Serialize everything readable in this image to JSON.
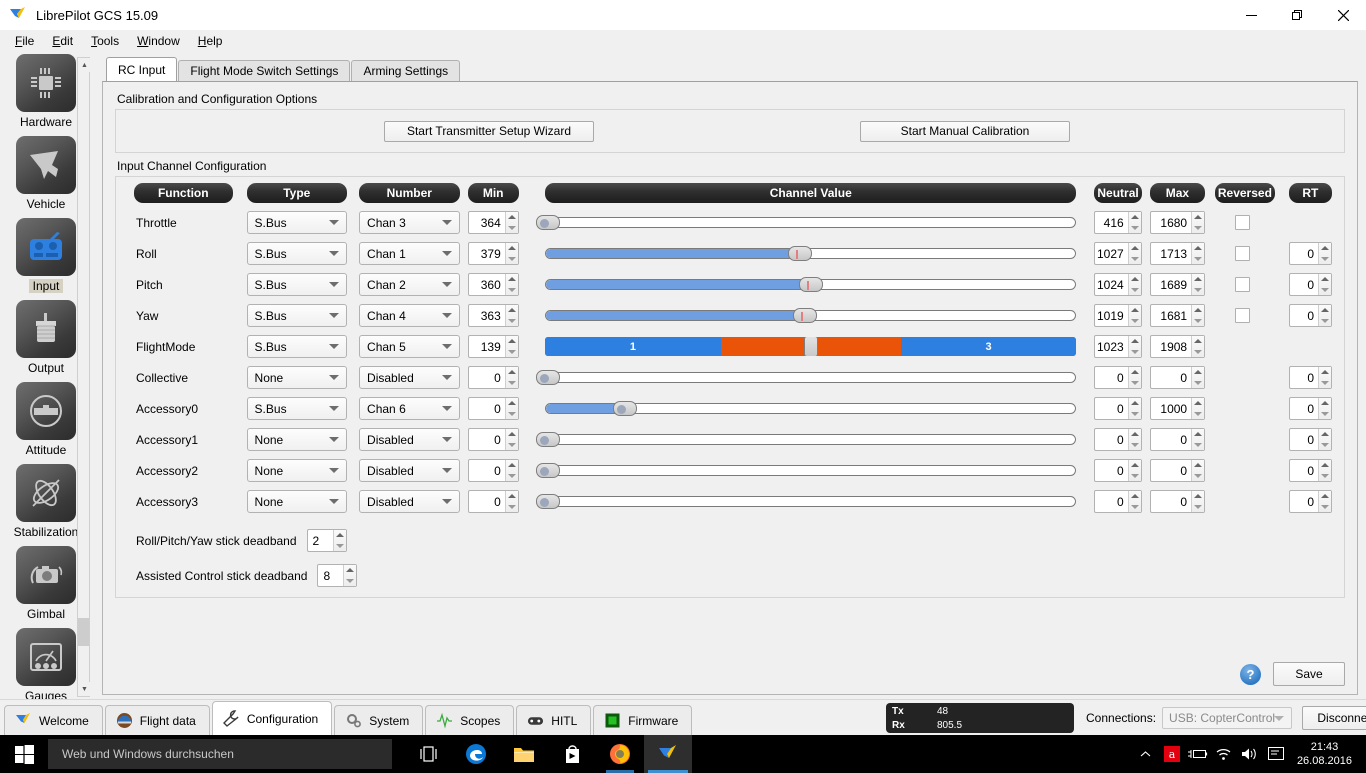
{
  "window": {
    "title": "LibrePilot GCS 15.09",
    "app_icon": "librepilot-logo-icon",
    "minimize": "–",
    "maximize": "❐",
    "close": "✕"
  },
  "menubar": [
    {
      "label": "File",
      "mnemonic": "F"
    },
    {
      "label": "Edit",
      "mnemonic": "E"
    },
    {
      "label": "Tools",
      "mnemonic": "T"
    },
    {
      "label": "Window",
      "mnemonic": "W"
    },
    {
      "label": "Help",
      "mnemonic": "H"
    }
  ],
  "sidebar": {
    "items": [
      {
        "label": "Hardware",
        "icon": "chip-icon",
        "selected": false
      },
      {
        "label": "Vehicle",
        "icon": "airplane-icon",
        "selected": false
      },
      {
        "label": "Input",
        "icon": "rc-transmitter-icon",
        "selected": true
      },
      {
        "label": "Output",
        "icon": "motor-icon",
        "selected": false
      },
      {
        "label": "Attitude",
        "icon": "spirit-level-icon",
        "selected": false
      },
      {
        "label": "Stabilization",
        "icon": "gyro-icon",
        "selected": false
      },
      {
        "label": "Gimbal",
        "icon": "camera-icon",
        "selected": false
      },
      {
        "label": "Gauges",
        "icon": "gauge-icon",
        "selected": false
      }
    ]
  },
  "tabs": [
    {
      "label": "RC Input",
      "active": true
    },
    {
      "label": "Flight Mode Switch Settings",
      "active": false
    },
    {
      "label": "Arming Settings",
      "active": false
    }
  ],
  "calibration": {
    "group_label": "Calibration and Configuration Options",
    "wizard_button": "Start Transmitter Setup Wizard",
    "manual_button": "Start Manual Calibration"
  },
  "input_config": {
    "group_label": "Input Channel Configuration",
    "headers": [
      "Function",
      "Type",
      "Number",
      "Min",
      "Channel Value",
      "Neutral",
      "Max",
      "Reversed",
      "RT"
    ],
    "rows": [
      {
        "function": "Throttle",
        "type": "S.Bus",
        "number": "Chan 3",
        "min": "364",
        "neutral": "416",
        "max": "1680",
        "reversed": false,
        "rt": "",
        "has_rt": false,
        "slider": {
          "style": "plain",
          "fill_pct": 0,
          "handle_pct": 0.5,
          "dot": true
        }
      },
      {
        "function": "Roll",
        "type": "S.Bus",
        "number": "Chan 1",
        "min": "379",
        "neutral": "1027",
        "max": "1713",
        "reversed": false,
        "rt": "0",
        "has_rt": true,
        "slider": {
          "style": "plain",
          "fill_pct": 48,
          "handle_pct": 48,
          "dot": false
        }
      },
      {
        "function": "Pitch",
        "type": "S.Bus",
        "number": "Chan 2",
        "min": "360",
        "neutral": "1024",
        "max": "1689",
        "reversed": false,
        "rt": "0",
        "has_rt": true,
        "slider": {
          "style": "plain",
          "fill_pct": 50,
          "handle_pct": 50,
          "dot": false
        }
      },
      {
        "function": "Yaw",
        "type": "S.Bus",
        "number": "Chan 4",
        "min": "363",
        "neutral": "1019",
        "max": "1681",
        "reversed": false,
        "rt": "0",
        "has_rt": true,
        "slider": {
          "style": "plain",
          "fill_pct": 49,
          "handle_pct": 49,
          "dot": false
        }
      },
      {
        "function": "FlightMode",
        "type": "S.Bus",
        "number": "Chan 5",
        "min": "139",
        "neutral": "1023",
        "max": "1908",
        "reversed": null,
        "rt": "",
        "has_rt": false,
        "slider": {
          "style": "flightmode",
          "handle_pct": 50,
          "segments": [
            {
              "label": "1",
              "start_pct": 0,
              "end_pct": 33,
              "color": "#2d7fe0"
            },
            {
              "label": "2",
              "start_pct": 33,
              "end_pct": 67,
              "color": "#ea5409"
            },
            {
              "label": "3",
              "start_pct": 67,
              "end_pct": 100,
              "color": "#2d7fe0"
            }
          ]
        }
      },
      {
        "function": "Collective",
        "type": "None",
        "number": "Disabled",
        "min": "0",
        "neutral": "0",
        "max": "0",
        "reversed": null,
        "rt": "0",
        "has_rt": true,
        "slider": {
          "style": "plain",
          "fill_pct": 0,
          "handle_pct": 0.5,
          "dot": true
        }
      },
      {
        "function": "Accessory0",
        "type": "S.Bus",
        "number": "Chan 6",
        "min": "0",
        "neutral": "0",
        "max": "1000",
        "reversed": null,
        "rt": "0",
        "has_rt": true,
        "slider": {
          "style": "plain",
          "fill_pct": 15,
          "handle_pct": 15,
          "dot": true
        }
      },
      {
        "function": "Accessory1",
        "type": "None",
        "number": "Disabled",
        "min": "0",
        "neutral": "0",
        "max": "0",
        "reversed": null,
        "rt": "0",
        "has_rt": true,
        "slider": {
          "style": "plain",
          "fill_pct": 0,
          "handle_pct": 0.5,
          "dot": true
        }
      },
      {
        "function": "Accessory2",
        "type": "None",
        "number": "Disabled",
        "min": "0",
        "neutral": "0",
        "max": "0",
        "reversed": null,
        "rt": "0",
        "has_rt": true,
        "slider": {
          "style": "plain",
          "fill_pct": 0,
          "handle_pct": 0.5,
          "dot": true
        }
      },
      {
        "function": "Accessory3",
        "type": "None",
        "number": "Disabled",
        "min": "0",
        "neutral": "0",
        "max": "0",
        "reversed": null,
        "rt": "0",
        "has_rt": true,
        "slider": {
          "style": "plain",
          "fill_pct": 0,
          "handle_pct": 0.5,
          "dot": true
        }
      }
    ],
    "deadbands": [
      {
        "label": "Roll/Pitch/Yaw stick deadband",
        "value": "2"
      },
      {
        "label": "Assisted Control stick deadband",
        "value": "8"
      }
    ]
  },
  "panel_footer": {
    "help_glyph": "?",
    "save_label": "Save"
  },
  "gcs_modes": [
    {
      "label": "Welcome",
      "icon": "librepilot-logo-icon",
      "active": false
    },
    {
      "label": "Flight data",
      "icon": "pilot-helmet-icon",
      "active": false
    },
    {
      "label": "Configuration",
      "icon": "wrench-icon",
      "active": true
    },
    {
      "label": "System",
      "icon": "gears-icon",
      "active": false
    },
    {
      "label": "Scopes",
      "icon": "waveform-icon",
      "active": false
    },
    {
      "label": "HITL",
      "icon": "gamepad-icon",
      "active": false
    },
    {
      "label": "Firmware",
      "icon": "chip-green-icon",
      "active": false
    }
  ],
  "telemetry": {
    "tx_label": "Tx",
    "rx_label": "Rx",
    "tx_value": "48",
    "rx_value": "805.5",
    "tx_leds": [
      "g",
      "off",
      "off",
      "off",
      "off",
      "off",
      "off"
    ],
    "rx_leds": [
      "g",
      "g",
      "g",
      "g",
      "y",
      "off",
      "off"
    ]
  },
  "connections": {
    "label": "Connections:",
    "selected": "USB: CopterControl",
    "disconnect_label": "Disconnect"
  },
  "taskbar": {
    "start_icon": "windows-logo-icon",
    "search_placeholder": "Web und Windows durchsuchen",
    "pinned": [
      {
        "icon": "task-view-icon",
        "running": false,
        "active": false
      },
      {
        "icon": "edge-icon",
        "running": false,
        "active": false
      },
      {
        "icon": "file-explorer-icon",
        "running": false,
        "active": false
      },
      {
        "icon": "store-icon",
        "running": false,
        "active": false
      },
      {
        "icon": "firefox-icon",
        "running": true,
        "active": false
      },
      {
        "icon": "librepilot-logo-icon",
        "running": true,
        "active": true
      }
    ],
    "tray": [
      {
        "icon": "chevron-up-icon"
      },
      {
        "icon": "avira-icon"
      },
      {
        "icon": "battery-charging-icon"
      },
      {
        "icon": "wifi-icon"
      },
      {
        "icon": "volume-icon"
      },
      {
        "icon": "action-center-icon"
      }
    ],
    "clock_time": "21:43",
    "clock_date": "26.08.2016"
  },
  "colors": {
    "accent_blue": "#2d7fe0",
    "slider_fill": "#6f9fe0",
    "flightmode_orange": "#ea5409",
    "header_dark": "#1d1d1d",
    "led_green": "#17c217",
    "led_yellow": "#f0bf10",
    "selection_bg": "#d6d2c3"
  }
}
